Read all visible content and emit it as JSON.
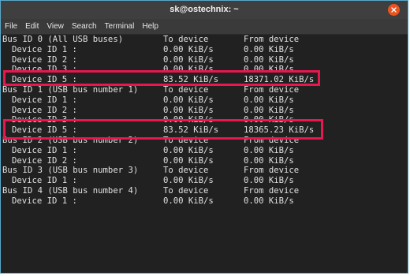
{
  "window": {
    "title": "sk@ostechnix: ~"
  },
  "menu": [
    "File",
    "Edit",
    "View",
    "Search",
    "Terminal",
    "Help"
  ],
  "lines": [
    {
      "c1": "Bus ID 0 (All USB buses)",
      "c2": "To device",
      "c3": "From device",
      "indent": false
    },
    {
      "c1": "Device ID 1 :",
      "c2": "0.00 KiB/s",
      "c3": "0.00 KiB/s",
      "indent": true
    },
    {
      "c1": "Device ID 2 :",
      "c2": "0.00 KiB/s",
      "c3": "0.00 KiB/s",
      "indent": true
    },
    {
      "c1": "Device ID 3 :",
      "c2": "0.00 KiB/s",
      "c3": "0.00 KiB/s",
      "indent": true
    },
    {
      "c1": "Device ID 5 :",
      "c2": "83.52 KiB/s",
      "c3": "18371.02 KiB/s",
      "indent": true
    },
    {
      "c1": "Bus ID 1 (USB bus number 1)",
      "c2": "To device",
      "c3": "From device",
      "indent": false
    },
    {
      "c1": "Device ID 1 :",
      "c2": "0.00 KiB/s",
      "c3": "0.00 KiB/s",
      "indent": true
    },
    {
      "c1": "Device ID 2 :",
      "c2": "0.00 KiB/s",
      "c3": "0.00 KiB/s",
      "indent": true
    },
    {
      "c1": "Device ID 3 :",
      "c2": "0.00 KiB/s",
      "c3": "0.00 KiB/s",
      "indent": true
    },
    {
      "c1": "Device ID 5 :",
      "c2": "83.52 KiB/s",
      "c3": "18365.23 KiB/s",
      "indent": true
    },
    {
      "c1": "Bus ID 2 (USB bus number 2)",
      "c2": "To device",
      "c3": "From device",
      "indent": false
    },
    {
      "c1": "Device ID 1 :",
      "c2": "0.00 KiB/s",
      "c3": "0.00 KiB/s",
      "indent": true
    },
    {
      "c1": "Device ID 2 :",
      "c2": "0.00 KiB/s",
      "c3": "0.00 KiB/s",
      "indent": true
    },
    {
      "c1": "Bus ID 3 (USB bus number 3)",
      "c2": "To device",
      "c3": "From device",
      "indent": false
    },
    {
      "c1": "Device ID 1 :",
      "c2": "0.00 KiB/s",
      "c3": "0.00 KiB/s",
      "indent": true
    },
    {
      "c1": "Bus ID 4 (USB bus number 4)",
      "c2": "To device",
      "c3": "From device",
      "indent": false
    },
    {
      "c1": "Device ID 1 :",
      "c2": "0.00 KiB/s",
      "c3": "0.00 KiB/s",
      "indent": true
    }
  ],
  "colors": {
    "highlight": "#e8174d",
    "close_button": "#e95420",
    "terminal_bg": "#212121",
    "terminal_fg": "#e1e1e1"
  }
}
